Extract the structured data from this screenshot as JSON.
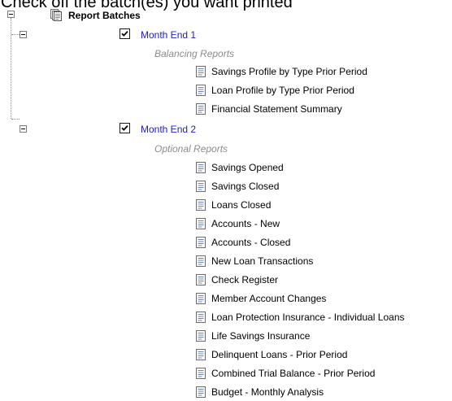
{
  "instruction": "Check off the batch(es) you want printed",
  "tree": {
    "root_label": "Report Batches",
    "batches": [
      {
        "label": "Month End 1",
        "checked": true,
        "group": "Balancing Reports",
        "reports": [
          "Savings Profile by Type Prior Period",
          "Loan Profile by Type Prior Period",
          "Financial Statement Summary"
        ]
      },
      {
        "label": "Month End 2",
        "checked": true,
        "group": "Optional Reports",
        "reports": [
          "Savings Opened",
          "Savings Closed",
          "Loans Closed",
          "Accounts - New",
          "Accounts - Closed",
          "New Loan Transactions",
          "Check Register",
          "Member Account Changes",
          "Loan Protection Insurance - Individual Loans",
          "Life Savings Insurance",
          "Delinquent Loans - Prior Period",
          "Combined Trial Balance - Prior Period",
          "Budget - Monthly Analysis"
        ]
      }
    ]
  },
  "colors": {
    "batch_link": "#1c1ccf",
    "group_label": "#8c8c8c",
    "tree_lines": "#8a8a8a"
  },
  "icons": {
    "root": "report-stack-icon",
    "report": "document-icon",
    "toggle": "collapse-minus-icon",
    "checkbox": "checkmark-icon"
  }
}
